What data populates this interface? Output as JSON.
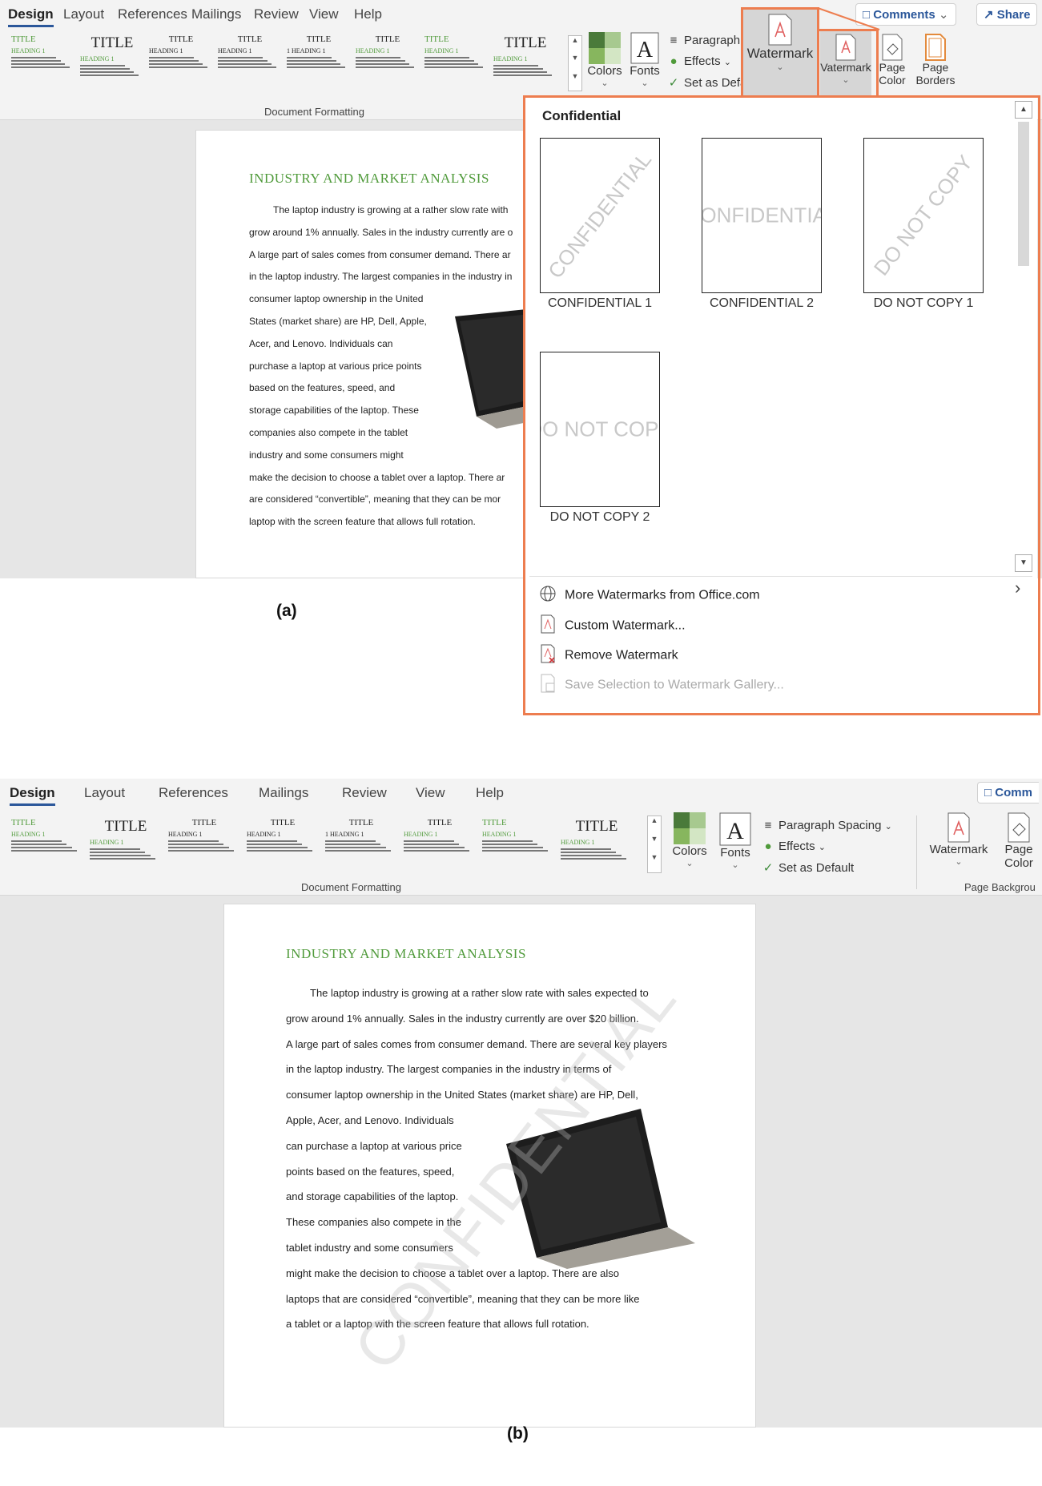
{
  "panel_a": {
    "tabs": [
      "Design",
      "Layout",
      "References",
      "Mailings",
      "Review",
      "View",
      "Help"
    ],
    "comments_label": "Comments",
    "share_label": "Share",
    "gallery": {
      "thumbs": [
        {
          "title": "TITLE",
          "heading": "HEADING 1"
        },
        {
          "title": "TITLE",
          "heading": "HEADING 1"
        },
        {
          "title": "TITLE",
          "heading": "HEADING 1"
        },
        {
          "title": "TITLE",
          "heading": "HEADING 1"
        },
        {
          "title": "TITLE",
          "heading": "1 HEADING 1"
        },
        {
          "title": "TITLE",
          "heading": "HEADING 1"
        },
        {
          "title": "TITLE",
          "heading": "HEADING 1"
        },
        {
          "title": "TITLE",
          "heading": "HEADING 1"
        }
      ],
      "group_label": "Document Formatting"
    },
    "colors_label": "Colors",
    "fonts_label": "Fonts",
    "paragraph_spacing_label": "Paragraph",
    "effects_label": "Effects",
    "set_default_label": "Set as Defa",
    "watermark_label": "Watermark",
    "watermark_small_label": "Vatermark",
    "page_color_label": "Page",
    "page_color_label2": "Color",
    "page_borders_label": "Page",
    "page_borders_label2": "Borders",
    "document": {
      "heading": "INDUSTRY AND MARKET ANALYSIS",
      "lines": [
        "The laptop industry is growing at a rather slow rate with",
        "grow around 1% annually.  Sales in the industry currently are o",
        "A large part of sales comes from consumer demand.   There ar",
        "in the laptop industry.  The largest companies in the industry in",
        "consumer laptop ownership in the United",
        "States (market share) are HP, Dell, Apple,",
        "Acer, and Lenovo.  Individuals can",
        "purchase a laptop at various price points",
        "based on the features, speed, and",
        "storage capabilities of the laptop. These",
        "companies also compete in the tablet",
        "industry and some consumers might",
        "make the decision to choose a tablet over a laptop.  There ar",
        "are considered “convertible”, meaning that they can be mor",
        "laptop with the screen feature that allows full rotation."
      ]
    },
    "dropdown": {
      "header": "Confidential",
      "items": [
        {
          "label": "CONFIDENTIAL 1",
          "text": "CONFIDENTIAL"
        },
        {
          "label": "CONFIDENTIAL 2",
          "text": "CONFIDENTIAL"
        },
        {
          "label": "DO NOT COPY 1",
          "text": "DO NOT COPY"
        },
        {
          "label": "DO NOT COPY 2",
          "text": "DO NOT COPY"
        }
      ],
      "menu": [
        {
          "label": "More Watermarks from Office.com",
          "icon": "globe-icon",
          "disabled": false
        },
        {
          "label": "Custom Watermark...",
          "icon": "custom-watermark-icon",
          "disabled": false
        },
        {
          "label": "Remove Watermark",
          "icon": "remove-watermark-icon",
          "disabled": false
        },
        {
          "label": "Save Selection to Watermark Gallery...",
          "icon": "save-gallery-icon",
          "disabled": true
        }
      ]
    },
    "caption": "(a)"
  },
  "panel_b": {
    "tabs": [
      "Design",
      "Layout",
      "References",
      "Mailings",
      "Review",
      "View",
      "Help"
    ],
    "comments_label": "Comm",
    "gallery": {
      "thumbs": [
        {
          "title": "TITLE",
          "heading": "HEADING 1"
        },
        {
          "title": "TITLE",
          "heading": "HEADING 1"
        },
        {
          "title": "TITLE",
          "heading": "HEADING 1"
        },
        {
          "title": "TITLE",
          "heading": "HEADING 1"
        },
        {
          "title": "TITLE",
          "heading": "1 HEADING 1"
        },
        {
          "title": "TITLE",
          "heading": "HEADING 1"
        },
        {
          "title": "TITLE",
          "heading": "HEADING 1"
        },
        {
          "title": "TITLE",
          "heading": "HEADING 1"
        }
      ],
      "group_label": "Document Formatting"
    },
    "colors_label": "Colors",
    "fonts_label": "Fonts",
    "paragraph_spacing_label": "Paragraph Spacing",
    "effects_label": "Effects",
    "set_default_label": "Set as Default",
    "watermark_label": "Watermark",
    "page_color_label": "Page",
    "page_color_label2": "Color",
    "page_background_label": "Page Backgrou",
    "document": {
      "heading": "INDUSTRY AND MARKET ANALYSIS",
      "lines": [
        "The laptop industry is growing at a rather slow rate with sales expected to",
        "grow around 1% annually.  Sales in the industry currently are over $20 billion.",
        "A large part of sales comes from consumer demand.  There are several key players",
        "in the laptop industry.  The largest companies in the industry in terms of",
        "consumer laptop ownership in the United States (market share) are HP, Dell,",
        "Apple, Acer, and Lenovo.  Individuals",
        "can purchase a laptop at various price",
        "points based on the features, speed,",
        "and storage capabilities of the laptop.",
        "These companies also compete in the",
        "tablet industry and some consumers",
        "might make the decision to choose a tablet over a laptop.  There are also",
        "laptops that are considered “convertible”, meaning that they can be more like",
        "a tablet or a laptop with the screen feature that allows full rotation."
      ],
      "watermark_text": "CONFIDENTIAL"
    },
    "caption": "(b)"
  },
  "colors": {
    "accent_orange": "#ed7d4f",
    "heading_green": "#4f9a3a",
    "word_blue": "#2b579a"
  }
}
